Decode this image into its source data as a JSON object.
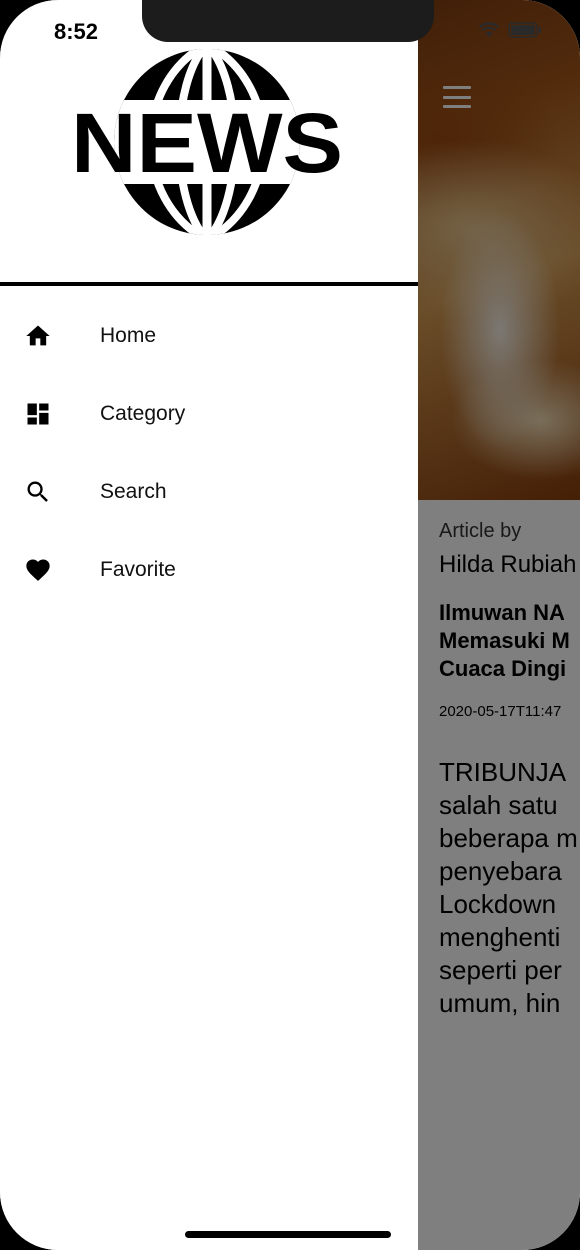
{
  "status_bar": {
    "time": "8:52"
  },
  "app": {
    "logo_text": "NEWS"
  },
  "drawer": {
    "items": [
      {
        "label": "Home",
        "icon": "home-icon"
      },
      {
        "label": "Category",
        "icon": "dashboard-icon"
      },
      {
        "label": "Search",
        "icon": "search-icon"
      },
      {
        "label": "Favorite",
        "icon": "heart-icon"
      }
    ]
  },
  "article": {
    "byline_label": "Article by",
    "author": "Hilda Rubiah",
    "title_lines": [
      "Ilmuwan NA",
      "Memasuki M",
      "Cuaca Dingi"
    ],
    "date": "2020-05-17T11:47",
    "content_lines": [
      "TRIBUNJA",
      "salah satu",
      "beberapa m",
      "penyebara",
      "Lockdown",
      "menghenti",
      "seperti per",
      "umum, hin"
    ]
  },
  "colors": {
    "hero_accent": "#a4561a",
    "scrim": "#000000"
  }
}
